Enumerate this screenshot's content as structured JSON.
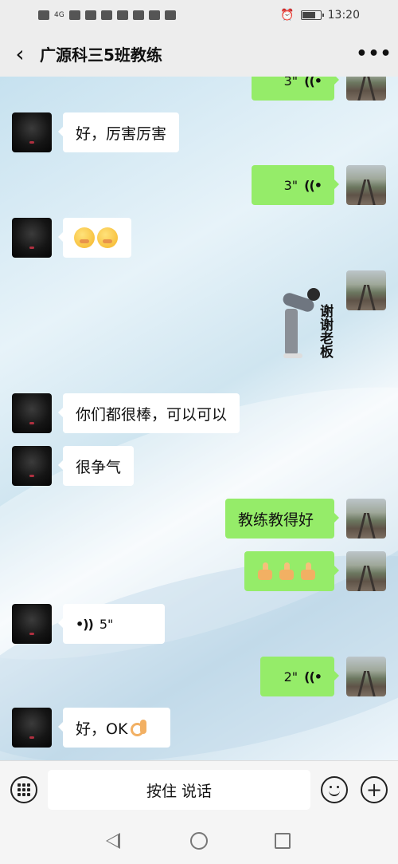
{
  "status_bar": {
    "network": "4G",
    "time": "13:20",
    "icons": [
      "hd-icon",
      "signal-icon",
      "wifi-icon",
      "tiktok-icon",
      "app-icon",
      "wps-icon",
      "browser-icon",
      "settings-icon",
      "alarm-icon",
      "battery-icon"
    ]
  },
  "header": {
    "back_label": "‹",
    "title": "广源科三5班教练",
    "more_label": "•••"
  },
  "messages": [
    {
      "side": "right",
      "type": "voice",
      "duration": "3\""
    },
    {
      "side": "left",
      "type": "text",
      "text": "好，厉害厉害"
    },
    {
      "side": "right",
      "type": "voice",
      "duration": "3\""
    },
    {
      "side": "left",
      "type": "emoji",
      "emoji": [
        "smile-hide-face-emoji",
        "smile-hide-face-emoji"
      ]
    },
    {
      "side": "right",
      "type": "sticker",
      "text": "谢谢老板"
    },
    {
      "side": "left",
      "type": "text",
      "text": "你们都很棒，可以可以"
    },
    {
      "side": "left",
      "type": "text",
      "text": "很争气"
    },
    {
      "side": "right",
      "type": "text",
      "text": "教练教得好"
    },
    {
      "side": "right",
      "type": "emoji",
      "emoji": [
        "thumbs-up-emoji",
        "thumbs-up-emoji",
        "thumbs-up-emoji"
      ]
    },
    {
      "side": "left",
      "type": "voice",
      "duration": "5\""
    },
    {
      "side": "right",
      "type": "voice",
      "duration": "2\""
    },
    {
      "side": "left",
      "type": "text",
      "text": "好，OK"
    }
  ],
  "input_bar": {
    "hold_to_talk": "按住 说话"
  },
  "colors": {
    "sent_bubble": "#95ec69",
    "received_bubble": "#ffffff",
    "bar_background": "#ededed"
  }
}
